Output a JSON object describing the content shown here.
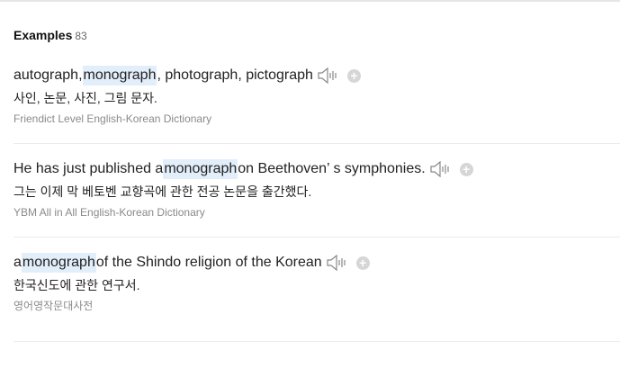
{
  "header": {
    "title": "Examples",
    "count": "83"
  },
  "examples": [
    {
      "en_before": "autograph, ",
      "en_highlight": "monograph",
      "en_after": ", photograph, pictograph",
      "ko": "사인, 논문, 사진, 그림 문자.",
      "source": "Friendict Level English-Korean Dictionary"
    },
    {
      "en_before": "He has just published a ",
      "en_highlight": "monograph",
      "en_after": " on Beethoven’ s symphonies.",
      "ko": "그는 이제 막 베토벤 교향곡에 관한 전공 논문을 출간했다.",
      "source": "YBM All in All English-Korean Dictionary"
    },
    {
      "en_before": "a ",
      "en_highlight": "monograph",
      "en_after": " of the Shindo religion of the Korean",
      "ko": "한국신도에 관한 연구서.",
      "source": "영어영작문대사전"
    }
  ],
  "icons": {
    "speaker": "speaker-icon",
    "add": "plus-circle-icon"
  },
  "colors": {
    "highlight": "#e3eefb",
    "source_text": "#8a8a8a",
    "plus_button": "#d6d6d6"
  }
}
